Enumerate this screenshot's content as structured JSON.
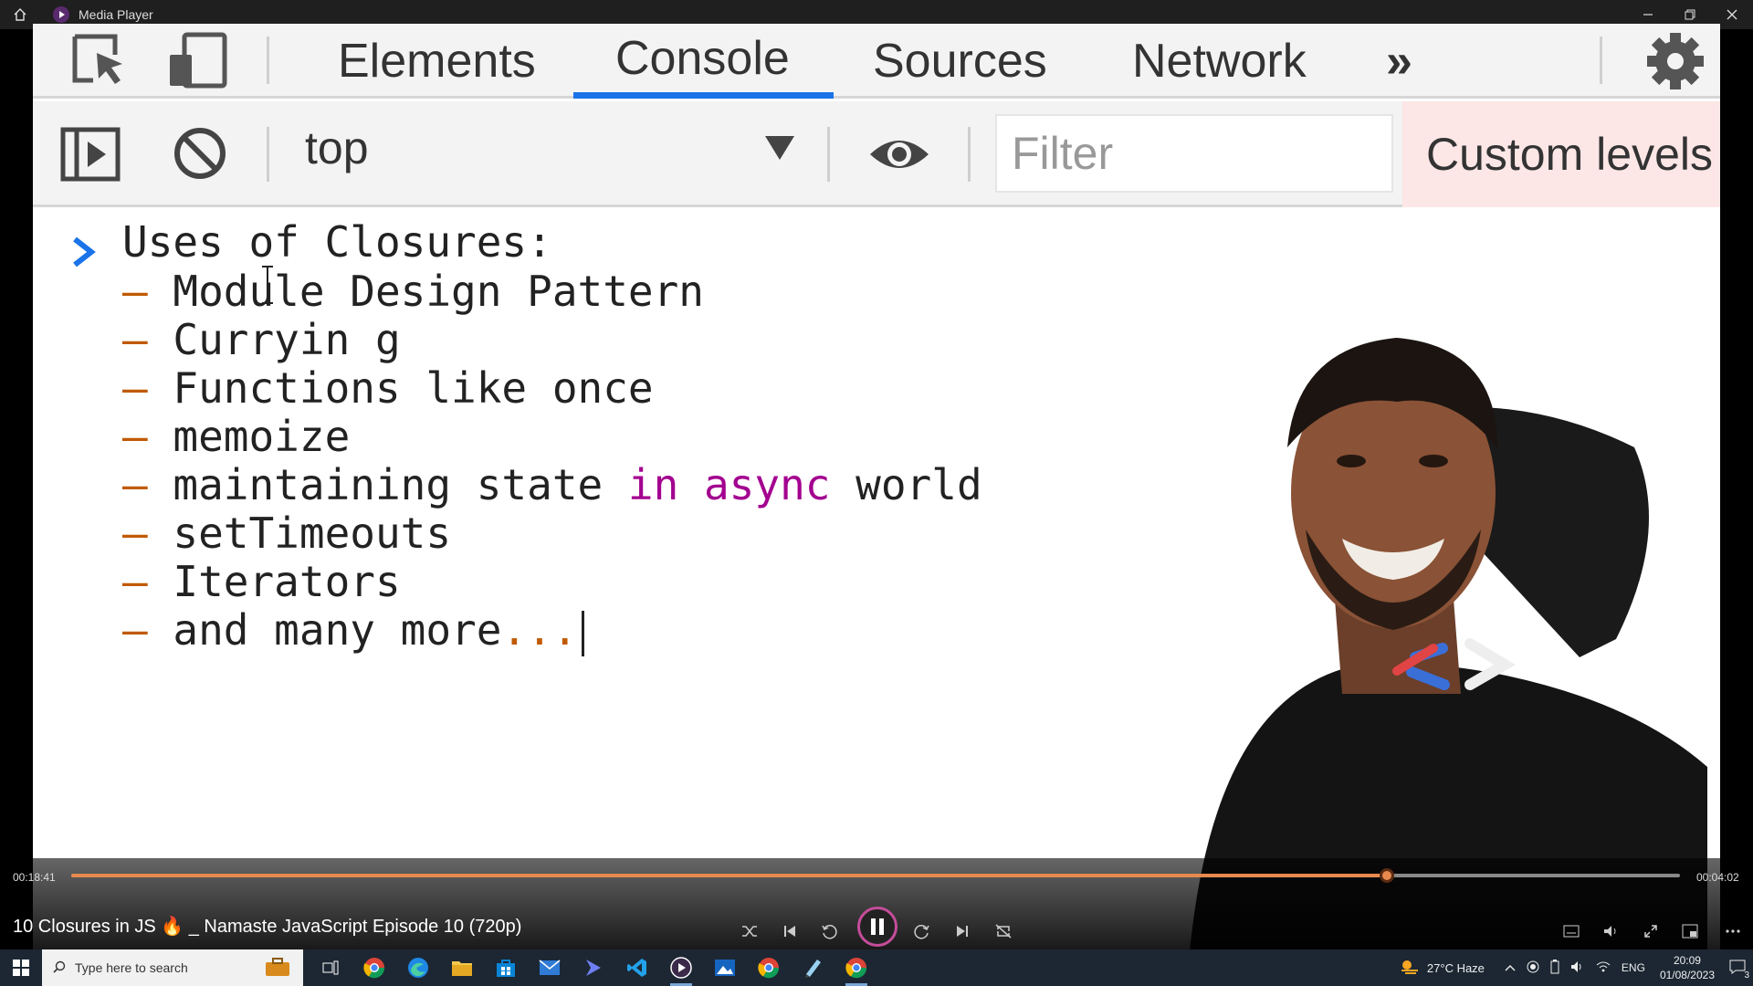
{
  "window": {
    "title": "Media Player"
  },
  "devtools": {
    "tabs": [
      "Elements",
      "Console",
      "Sources",
      "Network"
    ],
    "more_tabs_glyph": "»",
    "active_tab": "Console",
    "context": "top",
    "filter_placeholder": "Filter",
    "levels_label": "Custom levels"
  },
  "console": {
    "prompt_glyph": "›",
    "heading": "Uses of Closures:",
    "dash": "–",
    "items": [
      "Module Design Pattern",
      "Curryin g",
      "Functions like once",
      "memoize",
      "maintaining state in async world",
      "setTimeouts",
      "Iterators",
      "and many more..."
    ],
    "item_parts": {
      "state_prefix": "maintaining state ",
      "state_kw": "in async",
      "state_suffix": " world",
      "last_text": "and many more",
      "last_dots": "..."
    }
  },
  "player": {
    "elapsed": "00:18:41",
    "remaining": "00:04:02",
    "progress_fraction": 0.818,
    "video_title": "10 Closures in JS 🔥 _ Namaste JavaScript Episode 10 (720p)"
  },
  "taskbar": {
    "search_placeholder": "Type here to search",
    "weather": "27°C  Haze",
    "language": "ENG",
    "time": "20:09",
    "date": "01/08/2023",
    "notifications": "3"
  }
}
